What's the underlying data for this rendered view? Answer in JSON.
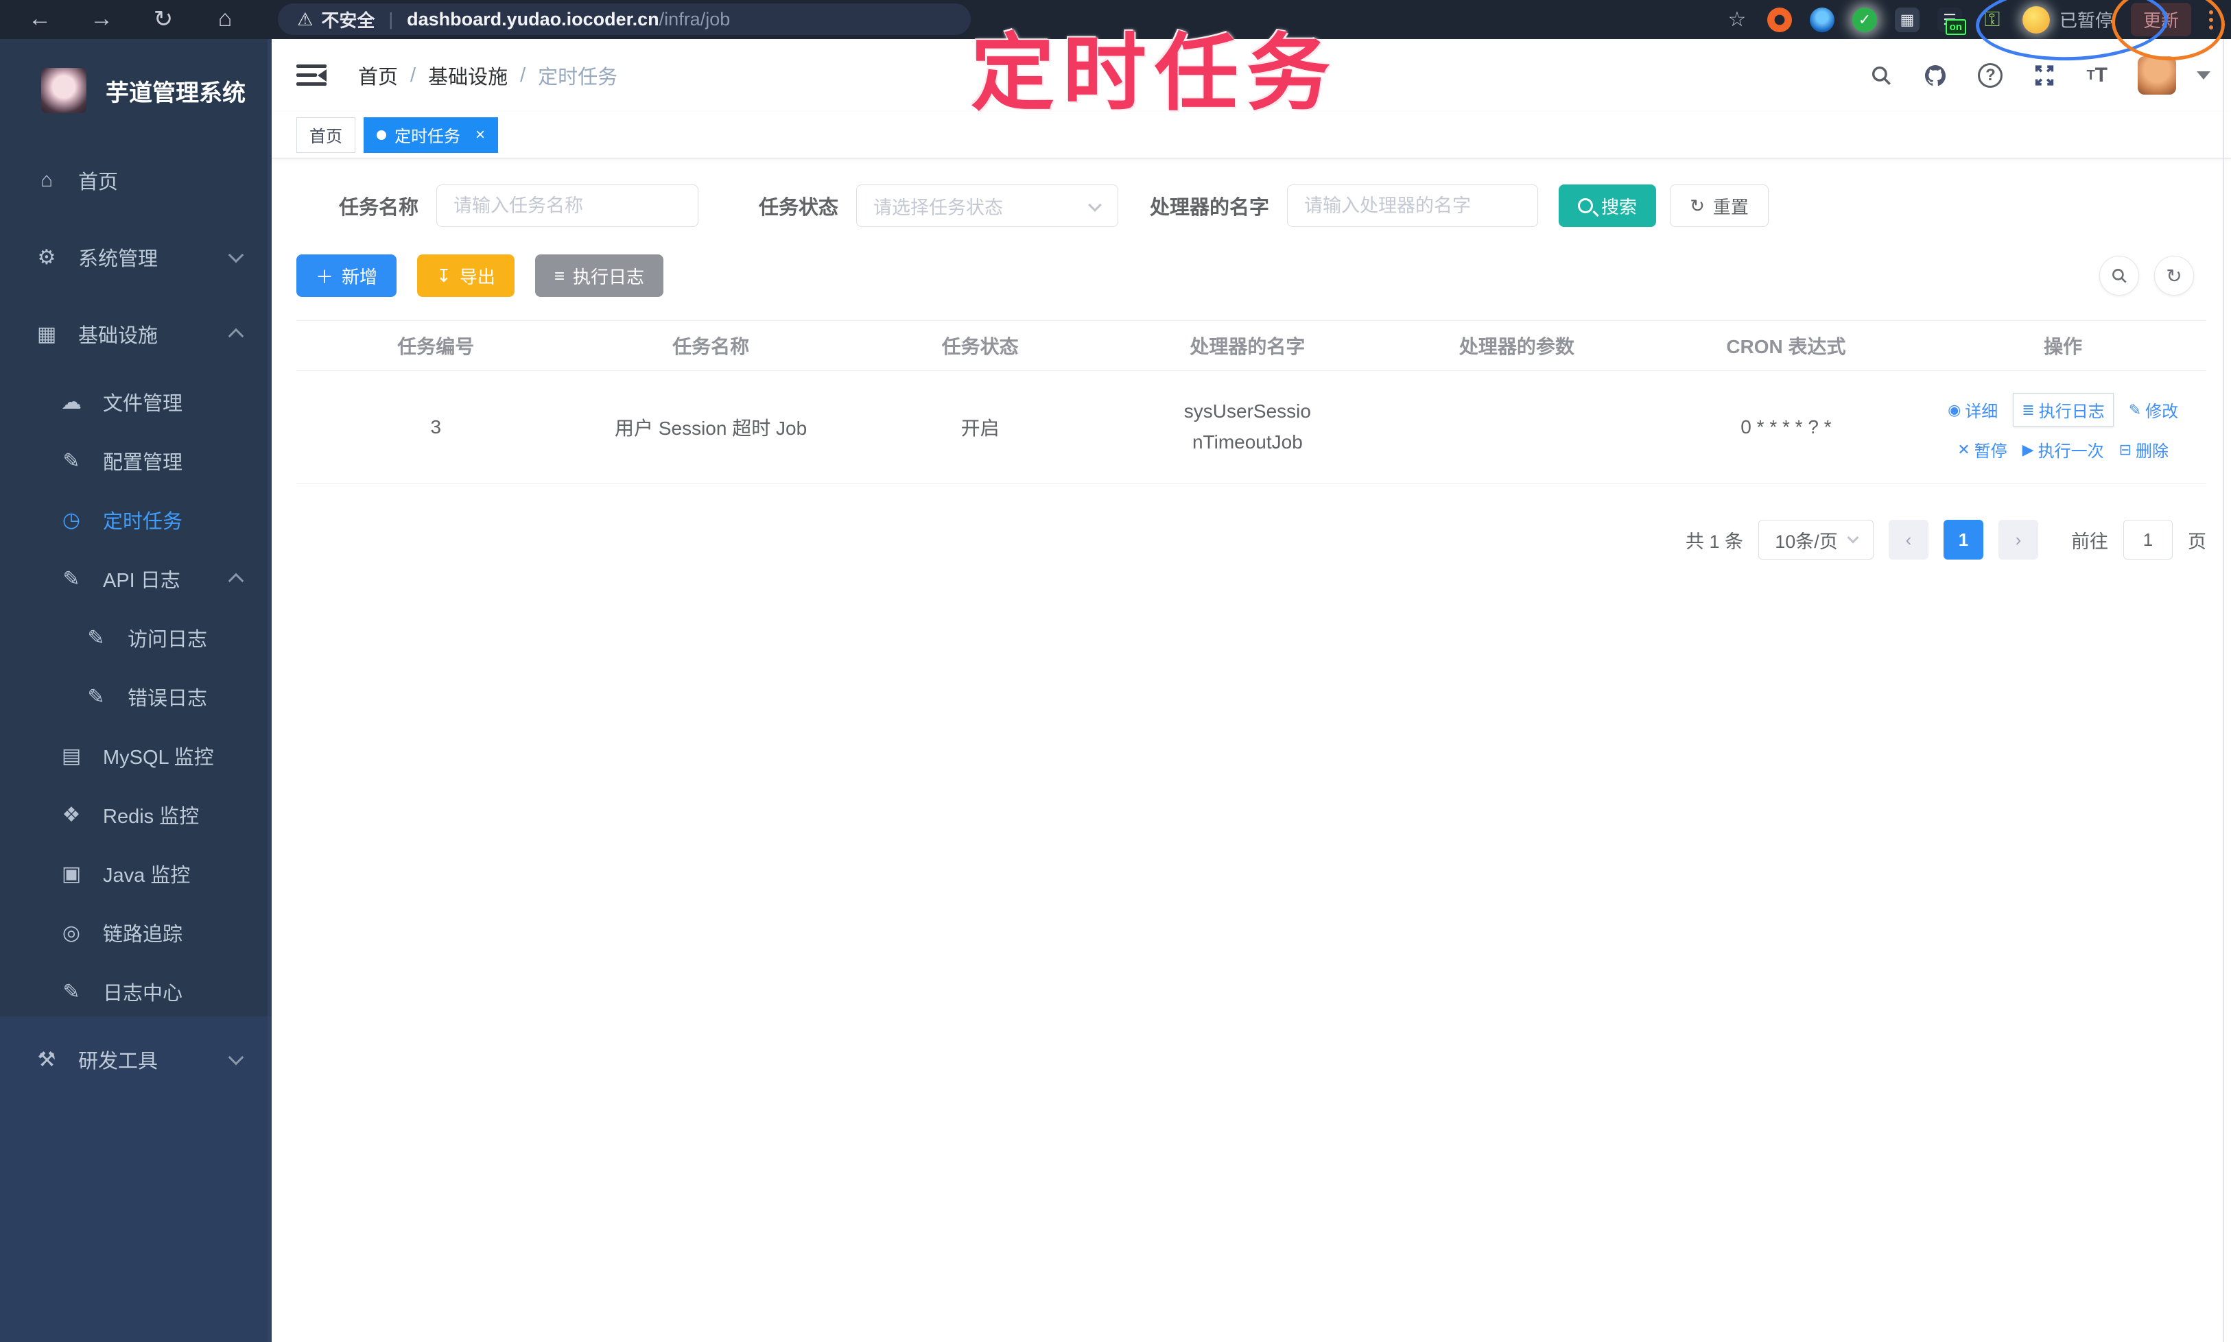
{
  "browser": {
    "security_label": "不安全",
    "url_host": "dashboard.yudao.iocoder.cn",
    "url_path": "/infra/job",
    "paused_label": "已暂停",
    "update_label": "更新",
    "extension_badge": "on"
  },
  "annotation": {
    "title": "定时任务"
  },
  "sidebar": {
    "app_title": "芋道管理系统",
    "items": [
      {
        "label": "首页"
      },
      {
        "label": "系统管理"
      },
      {
        "label": "基础设施"
      },
      {
        "label": "文件管理"
      },
      {
        "label": "配置管理"
      },
      {
        "label": "定时任务"
      },
      {
        "label": "API 日志"
      },
      {
        "label": "访问日志"
      },
      {
        "label": "错误日志"
      },
      {
        "label": "MySQL 监控"
      },
      {
        "label": "Redis 监控"
      },
      {
        "label": "Java 监控"
      },
      {
        "label": "链路追踪"
      },
      {
        "label": "日志中心"
      },
      {
        "label": "研发工具"
      }
    ]
  },
  "breadcrumb": {
    "items": [
      "首页",
      "基础设施",
      "定时任务"
    ]
  },
  "tags": {
    "home": "首页",
    "active": "定时任务",
    "close": "×"
  },
  "filters": {
    "name_label": "任务名称",
    "name_placeholder": "请输入任务名称",
    "status_label": "任务状态",
    "status_placeholder": "请选择任务状态",
    "handler_label": "处理器的名字",
    "handler_placeholder": "请输入处理器的名字",
    "search_label": "搜索",
    "reset_label": "重置"
  },
  "toolbar": {
    "add_label": "新增",
    "export_label": "导出",
    "log_label": "执行日志"
  },
  "table": {
    "headers": [
      "任务编号",
      "任务名称",
      "任务状态",
      "处理器的名字",
      "处理器的参数",
      "CRON 表达式",
      "操作"
    ],
    "row": {
      "id": "3",
      "name": "用户 Session 超时 Job",
      "status": "开启",
      "handler": "sysUserSessionTimeoutJob",
      "param": "",
      "cron": "0 * * * * ? *"
    },
    "actions": {
      "detail": "详细",
      "log": "执行日志",
      "edit": "修改",
      "pause": "暂停",
      "run_once": "执行一次",
      "delete": "删除"
    }
  },
  "pagination": {
    "total": "共 1 条",
    "size": "10条/页",
    "page": "1",
    "goto": "前往",
    "goto_value": "1",
    "unit": "页"
  },
  "colors": {
    "accent_blue": "#2f8df6",
    "link_blue": "#3d8ef7",
    "menu_active": "#409eff",
    "teal": "#1cb5a5",
    "amber": "#f9b218",
    "info_gray": "#909399",
    "tag_active": "#1d8df5",
    "sidebar_bg": "#283950",
    "topbar_bg": "#1d2632",
    "annotation_pink": "#f23a60",
    "ellipse_blue": "#3f7ef0",
    "ellipse_orange": "#f07c24"
  }
}
